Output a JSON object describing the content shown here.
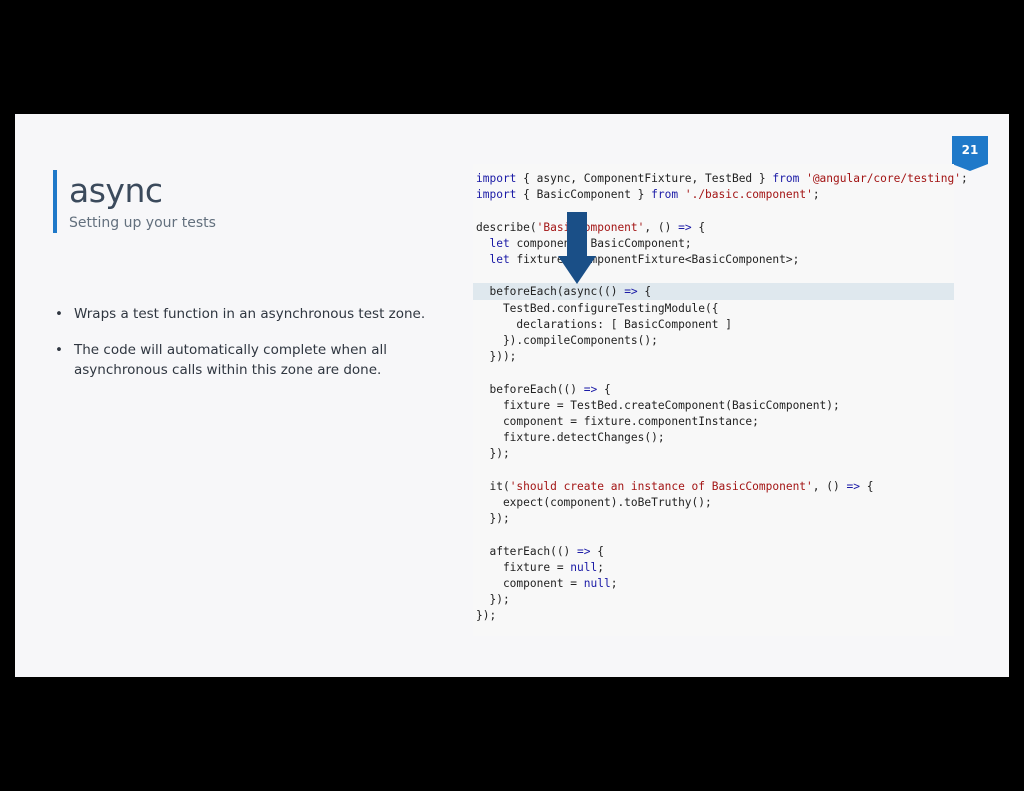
{
  "slide": {
    "title": "async",
    "subtitle": "Setting up your tests",
    "page_number": "21",
    "bullet_glyph": "•",
    "bullets": [
      "Wraps a test function in an asynchronous test zone.",
      "The code will automatically complete when all asynchronous calls within this zone are done."
    ]
  },
  "code": {
    "lines": [
      [
        {
          "t": "import",
          "c": "kw"
        },
        {
          "t": " { async, ComponentFixture, TestBed } "
        },
        {
          "t": "from",
          "c": "kw"
        },
        {
          "t": " "
        },
        {
          "t": "'@angular/core/testing'",
          "c": "str"
        },
        {
          "t": ";"
        }
      ],
      [
        {
          "t": "import",
          "c": "kw"
        },
        {
          "t": " { BasicComponent } "
        },
        {
          "t": "from",
          "c": "kw"
        },
        {
          "t": " "
        },
        {
          "t": "'./basic.component'",
          "c": "str"
        },
        {
          "t": ";"
        }
      ],
      [],
      [
        {
          "t": "describe("
        },
        {
          "t": "'BasicComponent'",
          "c": "str"
        },
        {
          "t": ", () "
        },
        {
          "t": "=>",
          "c": "kw"
        },
        {
          "t": " {"
        }
      ],
      [
        {
          "t": "  "
        },
        {
          "t": "let",
          "c": "kw"
        },
        {
          "t": " component: BasicComponent;"
        }
      ],
      [
        {
          "t": "  "
        },
        {
          "t": "let",
          "c": "kw"
        },
        {
          "t": " fixture: ComponentFixture<BasicComponent>;"
        }
      ],
      [],
      [
        {
          "t": "  beforeEach(async(() "
        },
        {
          "t": "=>",
          "c": "kw"
        },
        {
          "t": " {"
        }
      ],
      [
        {
          "t": "    TestBed.configureTestingModule({"
        }
      ],
      [
        {
          "t": "      declarations: [ BasicComponent ]"
        }
      ],
      [
        {
          "t": "    }).compileComponents();"
        }
      ],
      [
        {
          "t": "  }));"
        }
      ],
      [],
      [
        {
          "t": "  beforeEach(() "
        },
        {
          "t": "=>",
          "c": "kw"
        },
        {
          "t": " {"
        }
      ],
      [
        {
          "t": "    fixture = TestBed.createComponent(BasicComponent);"
        }
      ],
      [
        {
          "t": "    component = fixture.componentInstance;"
        }
      ],
      [
        {
          "t": "    fixture.detectChanges();"
        }
      ],
      [
        {
          "t": "  });"
        }
      ],
      [],
      [
        {
          "t": "  it("
        },
        {
          "t": "'should create an instance of BasicComponent'",
          "c": "str"
        },
        {
          "t": ", () "
        },
        {
          "t": "=>",
          "c": "kw"
        },
        {
          "t": " {"
        }
      ],
      [
        {
          "t": "    expect(component).toBeTruthy();"
        }
      ],
      [
        {
          "t": "  });"
        }
      ],
      [],
      [
        {
          "t": "  afterEach(() "
        },
        {
          "t": "=>",
          "c": "kw"
        },
        {
          "t": " {"
        }
      ],
      [
        {
          "t": "    fixture = "
        },
        {
          "t": "null",
          "c": "kw"
        },
        {
          "t": ";"
        }
      ],
      [
        {
          "t": "    component = "
        },
        {
          "t": "null",
          "c": "kw"
        },
        {
          "t": ";"
        }
      ],
      [
        {
          "t": "  });"
        }
      ],
      [
        {
          "t": "});"
        }
      ]
    ],
    "highlighted_line": 7
  },
  "colors": {
    "accent": "#1f79c9",
    "arrow": "#1a4f87",
    "highlight": "#dfe8ee",
    "keyword": "#1a1aa6",
    "string": "#a31515"
  },
  "icons": {
    "arrow": "down-arrow-icon",
    "badge": "page-number-badge-icon"
  }
}
